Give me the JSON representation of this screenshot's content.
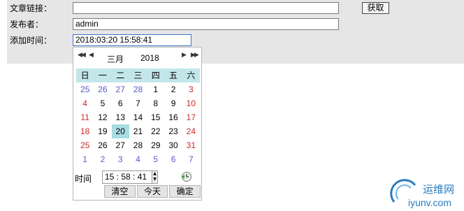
{
  "form": {
    "article_link": {
      "label": "文章链接：",
      "value": ""
    },
    "fetch_button": "获取",
    "publisher": {
      "label": "发布者：",
      "value": "admin"
    },
    "add_time": {
      "label": "添加时间：",
      "value": "2018:03:20 15:58:41"
    }
  },
  "calendar": {
    "prev_year": "◀◀",
    "prev_month": "◀",
    "month": "三月",
    "year": "2018",
    "next_month": "▶",
    "next_year": "▶▶",
    "weekdays": [
      "日",
      "一",
      "二",
      "三",
      "四",
      "五",
      "六"
    ],
    "weeks": [
      [
        "25",
        "26",
        "27",
        "28",
        "1",
        "2",
        "3"
      ],
      [
        "4",
        "5",
        "6",
        "7",
        "8",
        "9",
        "10"
      ],
      [
        "11",
        "12",
        "13",
        "14",
        "15",
        "16",
        "17"
      ],
      [
        "18",
        "19",
        "20",
        "21",
        "22",
        "23",
        "24"
      ],
      [
        "25",
        "26",
        "27",
        "28",
        "29",
        "30",
        "31"
      ],
      [
        "1",
        "2",
        "3",
        "4",
        "5",
        "6",
        "7"
      ]
    ],
    "selected_day": "20",
    "time_label": "时间",
    "time_value": "15 : 58 : 41",
    "clear_button": "清空",
    "today_button": "今天",
    "ok_button": "确定",
    "colors": {
      "header_bg": "#c2e6ea",
      "selected_bg": "#a8dde3",
      "weekend": "#cc2a2a",
      "other_month": "#5b5bc9"
    },
    "icons": {
      "spin": "spinner-arrows-icon",
      "clock": "clock-icon"
    }
  },
  "watermark": {
    "name": "运维网",
    "url": "iyunv.com"
  }
}
